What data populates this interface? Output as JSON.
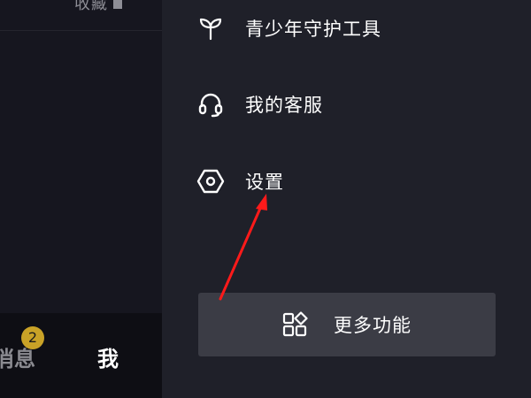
{
  "left": {
    "top_text": "收藏",
    "bottom_nav": {
      "messages_label": "消息",
      "messages_badge": "2",
      "me_label": "我"
    }
  },
  "drawer": {
    "items": [
      {
        "label": "青少年守护工具",
        "icon": "sprout-icon"
      },
      {
        "label": "我的客服",
        "icon": "headset-icon"
      },
      {
        "label": "设置",
        "icon": "settings-hexagon-icon"
      }
    ],
    "more_button": {
      "label": "更多功能",
      "icon": "apps-grid-icon"
    }
  },
  "annotation": {
    "arrow_color": "#ff1a1a"
  }
}
